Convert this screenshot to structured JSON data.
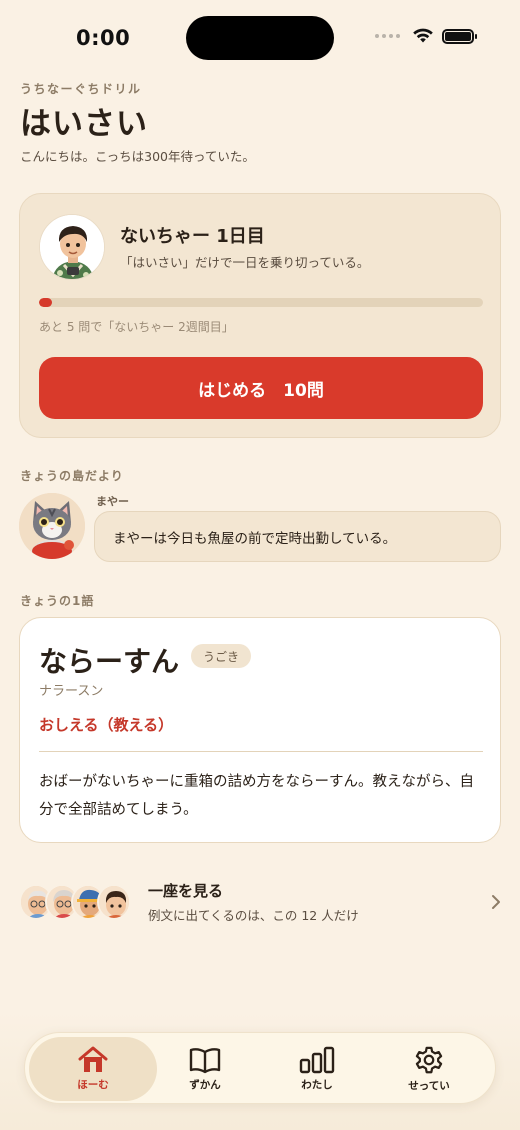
{
  "status_bar": {
    "time": "0:00"
  },
  "header": {
    "app_label": "うちなーぐちドリル",
    "title": "はいさい",
    "subtitle": "こんにちは。こっちは300年待っていた。"
  },
  "progress_card": {
    "level_title": "ないちゃー 1日目",
    "level_desc": "「はいさい」だけで一日を乗り切っている。",
    "progress_fraction": 0.03,
    "progress_text": "あと 5 問で「ないちゃー 2週間目」",
    "start_label": "はじめる　10問"
  },
  "island_news": {
    "section_label": "きょうの島だより",
    "speaker": "まやー",
    "message": "まやーは今日も魚屋の前で定時出勤している。"
  },
  "word_of_day": {
    "section_label": "きょうの1語",
    "word": "ならーすん",
    "tag": "うごき",
    "reading": "ナラースン",
    "meaning": "おしえる（教える）",
    "example": "おばーがないちゃーに重箱の詰め方をならーすん。教えながら、自分で全部詰めてしまう。"
  },
  "cast": {
    "title": "一座を見る",
    "subtitle": "例文に出てくるのは、この 12 人だけ"
  },
  "nav": {
    "items": [
      {
        "label": "ほーむ",
        "icon": "home-icon",
        "active": true
      },
      {
        "label": "ずかん",
        "icon": "book-icon",
        "active": false
      },
      {
        "label": "わたし",
        "icon": "bar-chart-icon",
        "active": false
      },
      {
        "label": "せってい",
        "icon": "gear-icon",
        "active": false
      }
    ]
  },
  "colors": {
    "accent": "#d93a2b",
    "background": "#faf1e4",
    "card": "#f3e6d2"
  }
}
